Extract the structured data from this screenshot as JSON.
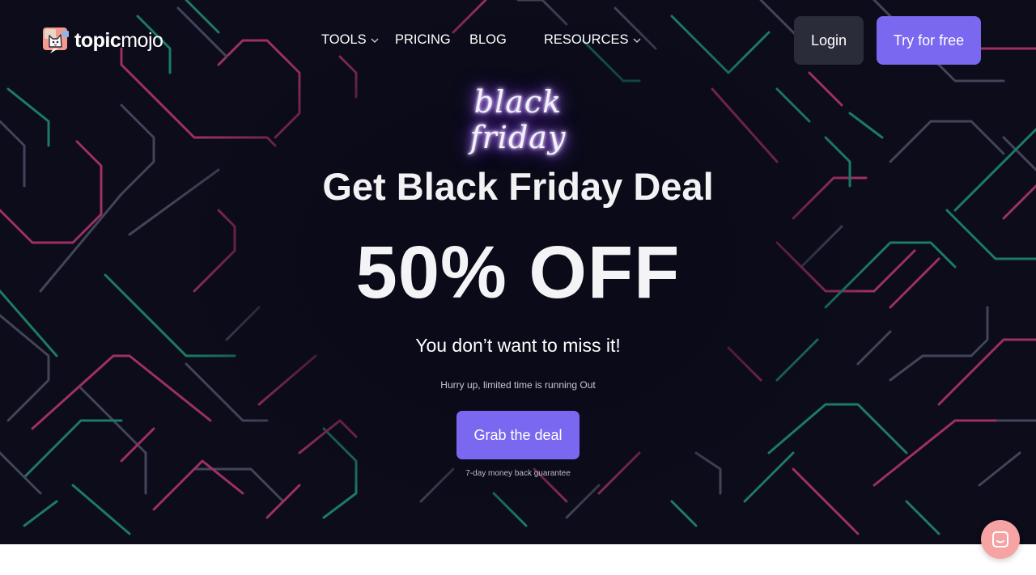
{
  "logo": {
    "part1": "topic",
    "part2": "mojo"
  },
  "nav": {
    "tools": "TOOLS",
    "pricing": "PRICING",
    "blog": "BLOG",
    "resources": "RESOURCES"
  },
  "header": {
    "login": "Login",
    "try_free": "Try for free"
  },
  "hero": {
    "neon_text": "black friday",
    "headline": "Get Black Friday Deal",
    "offer": "50% OFF",
    "subline": "You don’t want to miss it!",
    "hurry": "Hurry up, limited time is running Out",
    "cta": "Grab the deal",
    "guarantee": "7-day money back guarantee"
  },
  "colors": {
    "accent": "#7a68f0",
    "hero_bg": "#0c0c1a",
    "login_bg": "#2b2c3a",
    "chat_bubble": "#f5a3a3"
  },
  "icons": {
    "logo": "cat-mascot-icon",
    "dropdown": "chevron-down-icon",
    "chat": "chat-icon"
  }
}
